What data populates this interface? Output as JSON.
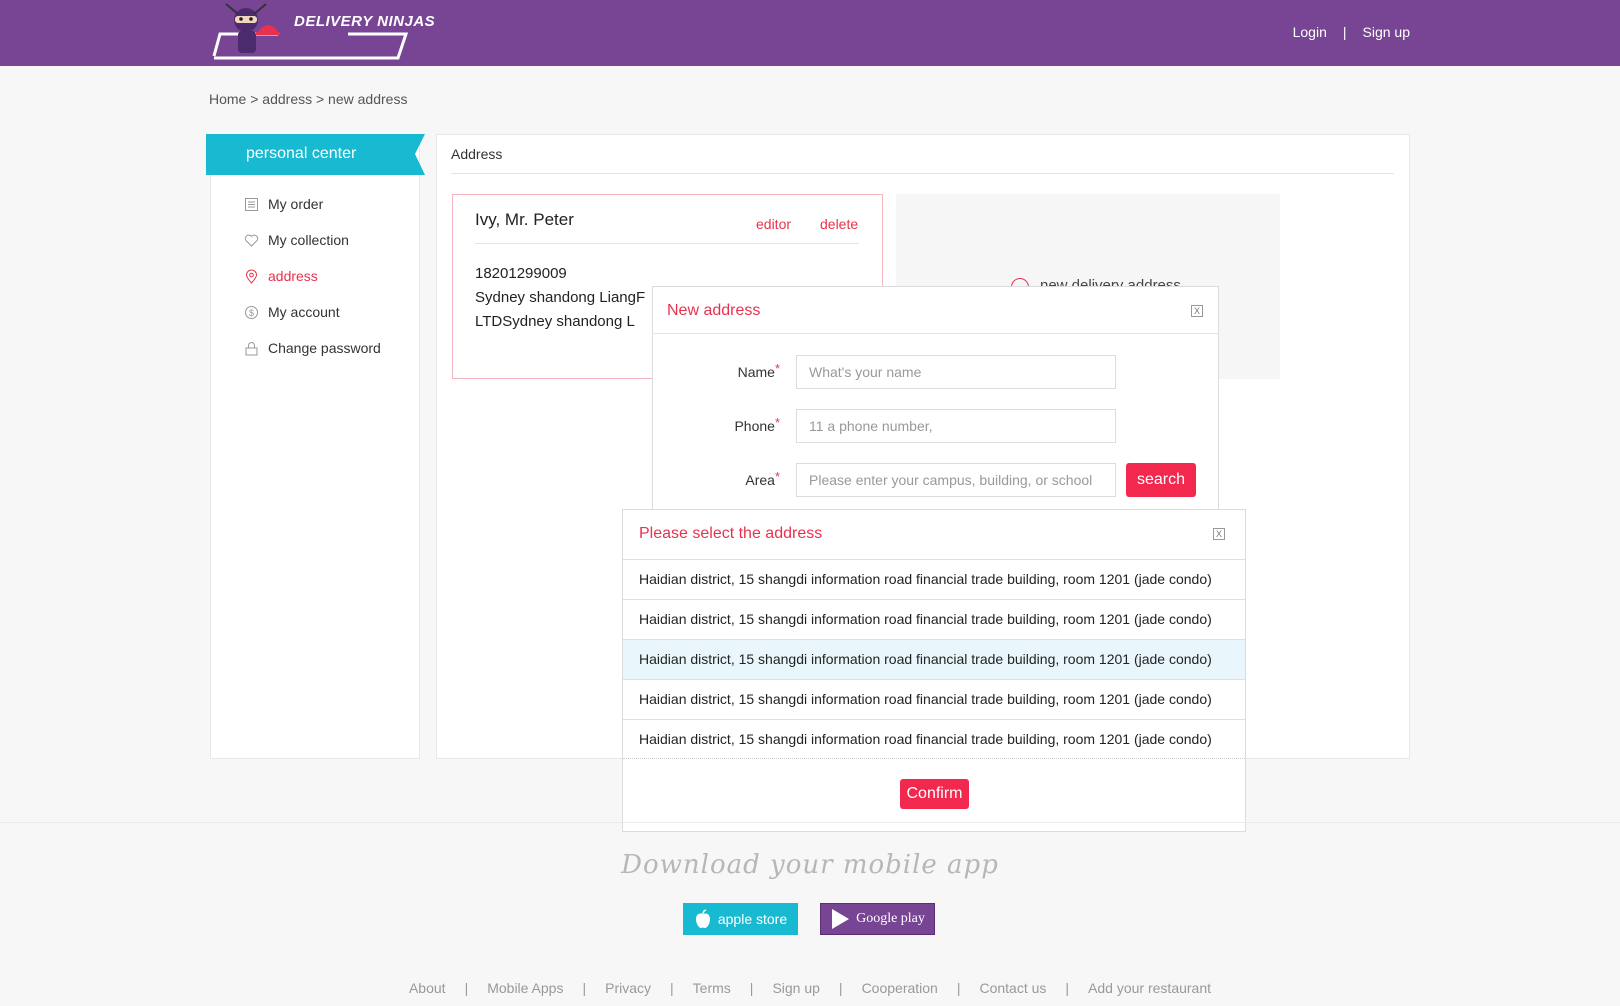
{
  "brand": {
    "name": "DELIVERY NINJAS",
    "header_bg": "#774594",
    "accent": "#f3284f"
  },
  "header": {
    "login": "Login",
    "separator": "|",
    "signup": "Sign up"
  },
  "breadcrumb": "Home > address > new address",
  "sidebar": {
    "title": "personal center",
    "items": [
      {
        "label": "My order",
        "icon": "list-icon"
      },
      {
        "label": "My collection",
        "icon": "heart-icon"
      },
      {
        "label": "address",
        "icon": "location-pin-icon",
        "active": true
      },
      {
        "label": "My account",
        "icon": "dollar-coin-icon"
      },
      {
        "label": "Change password",
        "icon": "lock-icon"
      }
    ]
  },
  "main": {
    "title": "Address",
    "address_card": {
      "name": "Ivy, Mr. Peter",
      "edit_label": "editor",
      "delete_label": "delete",
      "phone": "18201299009",
      "line1": "Sydney shandong LiangF",
      "line2": " LTDSydney shandong L"
    },
    "new_address_card": {
      "label": "new delivery address"
    }
  },
  "new_address_modal": {
    "title": "New address",
    "close": "X",
    "name_label": "Name",
    "name_placeholder": "What's your name",
    "phone_label": "Phone",
    "phone_placeholder": "11 a phone number,",
    "area_label": "Area",
    "area_placeholder": "Please enter your campus, building, or school",
    "required_mark": "*",
    "search_label": "search"
  },
  "select_modal": {
    "title": "Please select the address",
    "close": "X",
    "options": [
      "Haidian district, 15 shangdi information road financial trade building, room 1201 (jade condo)",
      "Haidian district, 15 shangdi information road financial trade building, room 1201 (jade condo)",
      "Haidian district, 15 shangdi information road financial trade building, room 1201 (jade condo)",
      "Haidian district, 15 shangdi information road financial trade building, room 1201 (jade condo)",
      "Haidian district, 15 shangdi information road financial trade building, room 1201 (jade condo)"
    ],
    "highlighted_index": 2,
    "confirm_label": "Confirm"
  },
  "footer": {
    "download_title": "Download your mobile app",
    "apple_label": "apple store",
    "google_label": "Google play",
    "links": [
      "About",
      "Mobile Apps",
      "Privacy",
      "Terms",
      "Sign up",
      "Cooperation",
      "Contact us",
      "Add your restaurant"
    ],
    "separator": "|"
  }
}
